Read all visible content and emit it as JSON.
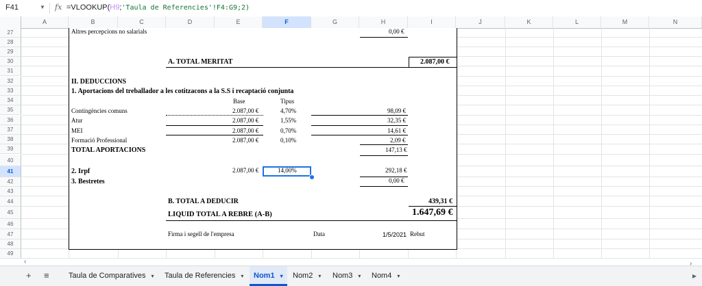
{
  "formula_bar": {
    "name_box": "F41",
    "fx": "fx",
    "formula_prefix": "=VLOOKUP(",
    "formula_ref": "H9",
    "formula_sep": ";",
    "formula_str": "'Taula de Referencies'!F4:G9;2)"
  },
  "columns": [
    "A",
    "B",
    "C",
    "D",
    "E",
    "F",
    "G",
    "H",
    "I",
    "J",
    "K",
    "L",
    "M",
    "N"
  ],
  "rows": [
    "27",
    "28",
    "29",
    "30",
    "31",
    "32",
    "33",
    "34",
    "35",
    "36",
    "37",
    "38",
    "39",
    "40",
    "41",
    "42",
    "43",
    "44",
    "45",
    "46",
    "47",
    "48",
    "49"
  ],
  "selected_column": "F",
  "selected_row": "41",
  "payroll": {
    "altres": "Altres percepcions no salarials",
    "altres_val": "0,00 €",
    "total_meritat_label": "A. TOTAL MERITAT",
    "total_meritat_val": "2.087,00 €",
    "deduccions": "II. DEDUCCIONS",
    "aportacions": "1. Aportacions del treballador a les cotitzacons a la S.S i recaptació conjunta",
    "base_hdr": "Base",
    "tipus_hdr": "Tipus",
    "items": [
      {
        "label": "Contingències comuns",
        "base": "2.087,00 €",
        "tipus": "4,70%",
        "val": "98,09 €"
      },
      {
        "label": "Atur",
        "base": "2.087,00 €",
        "tipus": "1,55%",
        "val": "32,35 €"
      },
      {
        "label": "MEI",
        "base": "2.087,00 €",
        "tipus": "0,70%",
        "val": "14,61 €"
      },
      {
        "label": "Formació Professional",
        "base": "2.087,00 €",
        "tipus": "0,10%",
        "val": "2,09 €"
      }
    ],
    "total_aport_label": "TOTAL APORTACIONS",
    "total_aport_val": "147,13 €",
    "irpf_label": "2. Irpf",
    "irpf_base": "2.087,00 €",
    "irpf_tipus": "14,00%",
    "irpf_val": "292,18 €",
    "bestretes_label": "3. Bestretes",
    "bestretes_val": "0,00 €",
    "total_deduir_label": "B. TOTAL A DEDUCIR",
    "total_deduir_val": "439,31 €",
    "liquid_label": "LIQUID TOTAL A REBRE (A-B)",
    "liquid_val": "1.647,69 €",
    "firma": "Firma i segell de l'empresa",
    "data_label": "Data",
    "data_val": "1/5/2021",
    "rebut": "Rebut"
  },
  "tabs": {
    "add": "+",
    "list": "≡",
    "items": [
      {
        "label": "Taula de Comparatives",
        "active": false
      },
      {
        "label": "Taula de Referencies",
        "active": false
      },
      {
        "label": "Nom1",
        "active": true
      },
      {
        "label": "Nom2",
        "active": false
      },
      {
        "label": "Nom3",
        "active": false
      },
      {
        "label": "Nom4",
        "active": false
      }
    ],
    "caret": "▾",
    "more": "▸"
  }
}
